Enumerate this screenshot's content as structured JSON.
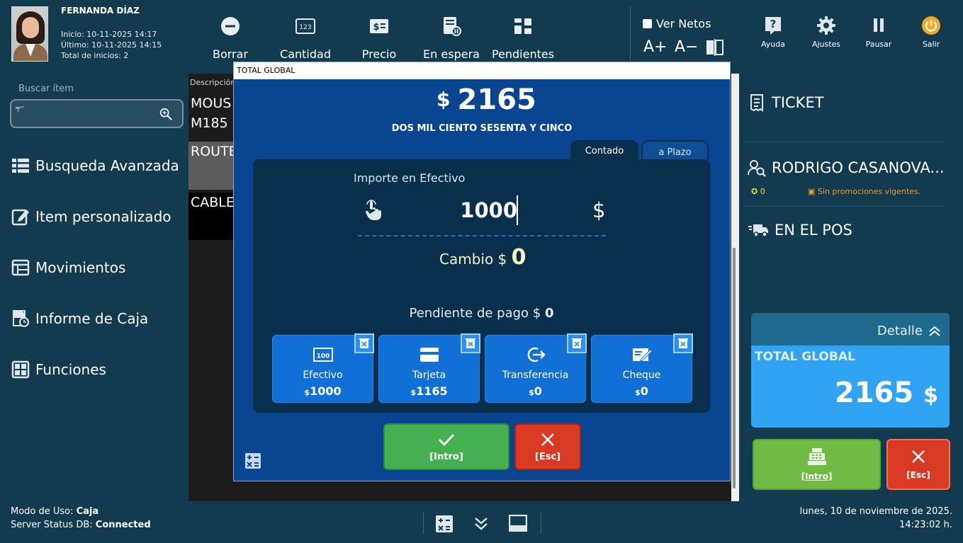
{
  "user": {
    "name": "FERNANDA DÍAZ",
    "inicio": "Inicio: 10-11-2025 14:17",
    "ultimo": "Último: 10-11-2025 14:15",
    "total_inicios": "Total de inicios: 2"
  },
  "search": {
    "label": "Buscar ítem",
    "value": ""
  },
  "menu": [
    {
      "label": "Busqueda Avanzada",
      "icon": "list-icon"
    },
    {
      "label": "Item personalizado",
      "icon": "edit-icon"
    },
    {
      "label": "Movimientos",
      "icon": "calendar-icon"
    },
    {
      "label": "Informe de Caja",
      "icon": "report-clock-icon"
    },
    {
      "label": "Funciones",
      "icon": "grid-icon"
    }
  ],
  "toolbar": {
    "borrar": "Borrar",
    "cantidad": "Cantidad",
    "precio": "Precio",
    "en_espera": "En espera",
    "pendientes": "Pendientes",
    "ver_netos": "Ver Netos",
    "font_up": "A+",
    "font_down": "A−"
  },
  "items": {
    "col_descripcion": "Descripción",
    "rows": [
      "MOUS",
      "M185",
      "ROUTE",
      "CABLE"
    ]
  },
  "right_toolbar": {
    "ayuda": "Ayuda",
    "ajustes": "Ajustes",
    "pausar": "Pausar",
    "salir": "Salir"
  },
  "right_panel": {
    "ticket": "TICKET",
    "client_name": "RODRIGO CASANOVA...",
    "points": "0",
    "promo": "Sin promociones vigentes.",
    "en_el_pos": "EN EL POS",
    "detalle": "Detalle",
    "total_label": "TOTAL GLOBAL",
    "total_value": "2165",
    "currency": "$",
    "ok_label": "[Intro]",
    "cancel_label": "[Esc]"
  },
  "modal": {
    "title": "TOTAL GLOBAL",
    "currency": "$",
    "total": "2165",
    "total_words": "DOS MIL CIENTO SESENTA Y CINCO",
    "tab_contado": "Contado",
    "tab_plazo": "a Plazo",
    "importe_label": "Importe en Efectivo",
    "importe_value": "1000",
    "cambio_label": "Cambio $",
    "cambio_value": "0",
    "pendiente_label": "Pendiente de pago $",
    "pendiente_value": "0",
    "methods": [
      {
        "name": "Efectivo",
        "value": "1000",
        "icon": "cash-icon"
      },
      {
        "name": "Tarjeta",
        "value": "1165",
        "icon": "card-icon"
      },
      {
        "name": "Transferencia",
        "value": "0",
        "icon": "transfer-icon"
      },
      {
        "name": "Cheque",
        "value": "0",
        "icon": "cheque-icon"
      }
    ],
    "ok_label": "[Intro]",
    "cancel_label": "[Esc]"
  },
  "status": {
    "modo_label": "Modo de Uso:",
    "modo_value": "Caja",
    "server_label": "Server Status DB:",
    "server_value": "Connected",
    "date": "lunes, 10 de noviembre de 2025.",
    "time": "14:23:02 h."
  },
  "colors": {
    "background": "#123b50",
    "modal_bg": "#0a4591",
    "panel_dark": "#082f4c",
    "method_card": "#1170d6",
    "confirm_green": "#45b052",
    "cancel_red": "#d93a24",
    "total_blue": "#30a3f2"
  }
}
